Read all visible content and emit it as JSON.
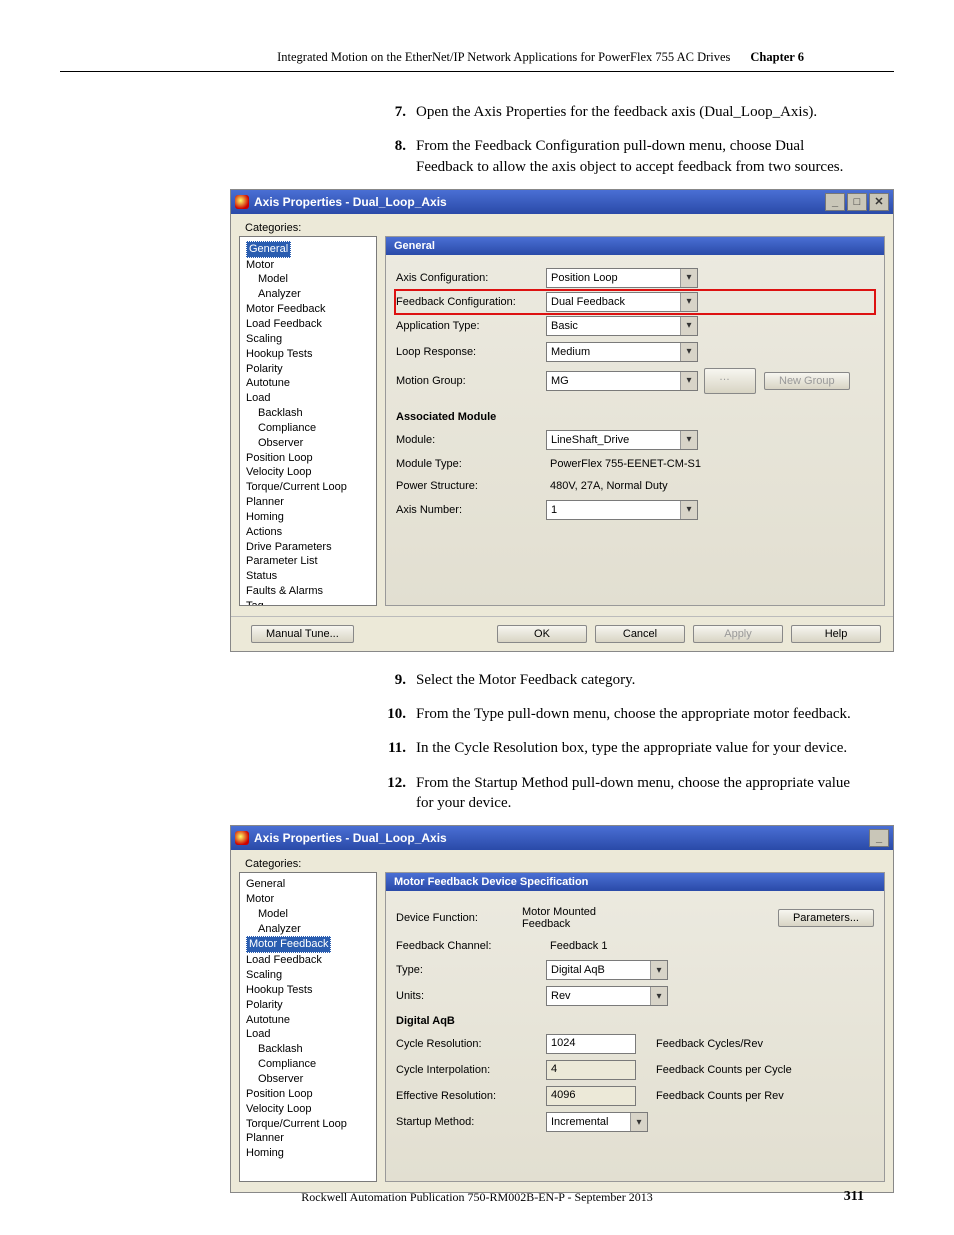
{
  "header": {
    "doc_title": "Integrated Motion on the EtherNet/IP Network Applications for PowerFlex 755 AC Drives",
    "chapter": "Chapter 6"
  },
  "steps_a": [
    {
      "n": "7.",
      "t": "Open the Axis Properties for the feedback axis (Dual_Loop_Axis)."
    },
    {
      "n": "8.",
      "t": "From the Feedback Configuration pull-down menu, choose Dual Feedback to allow the axis object to accept feedback from two sources."
    }
  ],
  "screenshot1": {
    "title": "Axis Properties - Dual_Loop_Axis",
    "categories_label": "Categories:",
    "tree": [
      {
        "l": 0,
        "label": "General",
        "sel": true
      },
      {
        "l": 0,
        "label": "Motor"
      },
      {
        "l": 1,
        "label": "Model"
      },
      {
        "l": 1,
        "label": "Analyzer"
      },
      {
        "l": 0,
        "label": "Motor Feedback"
      },
      {
        "l": 0,
        "label": "Load Feedback"
      },
      {
        "l": 0,
        "label": "Scaling"
      },
      {
        "l": 0,
        "label": "Hookup Tests"
      },
      {
        "l": 0,
        "label": "Polarity"
      },
      {
        "l": 0,
        "label": "Autotune"
      },
      {
        "l": 0,
        "label": "Load"
      },
      {
        "l": 1,
        "label": "Backlash"
      },
      {
        "l": 1,
        "label": "Compliance"
      },
      {
        "l": 1,
        "label": "Observer"
      },
      {
        "l": 0,
        "label": "Position Loop"
      },
      {
        "l": 0,
        "label": "Velocity Loop"
      },
      {
        "l": 0,
        "label": "Torque/Current Loop"
      },
      {
        "l": 0,
        "label": "Planner"
      },
      {
        "l": 0,
        "label": "Homing"
      },
      {
        "l": 0,
        "label": "Actions"
      },
      {
        "l": 0,
        "label": "Drive Parameters"
      },
      {
        "l": 0,
        "label": "Parameter List"
      },
      {
        "l": 0,
        "label": "Status"
      },
      {
        "l": 0,
        "label": "Faults & Alarms"
      },
      {
        "l": 0,
        "label": "Tag"
      }
    ],
    "panel_title": "General",
    "fields": {
      "axis_config_label": "Axis Configuration:",
      "axis_config_value": "Position Loop",
      "fb_config_label": "Feedback Configuration:",
      "fb_config_value": "Dual Feedback",
      "app_type_label": "Application Type:",
      "app_type_value": "Basic",
      "loop_resp_label": "Loop Response:",
      "loop_resp_value": "Medium",
      "motion_group_label": "Motion Group:",
      "motion_group_value": "MG",
      "new_group_btn": "New Group",
      "assoc_label": "Associated Module",
      "module_label": "Module:",
      "module_value": "LineShaft_Drive",
      "module_type_label": "Module Type:",
      "module_type_value": "PowerFlex 755-EENET-CM-S1",
      "power_struct_label": "Power Structure:",
      "power_struct_value": "480V, 27A, Normal Duty",
      "axis_num_label": "Axis Number:",
      "axis_num_value": "1"
    },
    "footer": {
      "manual_tune": "Manual Tune...",
      "ok": "OK",
      "cancel": "Cancel",
      "apply": "Apply",
      "help": "Help"
    }
  },
  "steps_b": [
    {
      "n": "9.",
      "t": "Select the Motor Feedback category."
    },
    {
      "n": "10.",
      "t": "From the Type pull-down menu, choose the appropriate motor feedback."
    },
    {
      "n": "11.",
      "t": "In the Cycle Resolution box, type the appropriate value for your device."
    },
    {
      "n": "12.",
      "t": "From the Startup Method pull-down menu, choose the appropriate value for your device."
    }
  ],
  "screenshot2": {
    "title": "Axis Properties - Dual_Loop_Axis",
    "categories_label": "Categories:",
    "tree": [
      {
        "l": 0,
        "label": "General"
      },
      {
        "l": 0,
        "label": "Motor"
      },
      {
        "l": 1,
        "label": "Model"
      },
      {
        "l": 1,
        "label": "Analyzer"
      },
      {
        "l": 0,
        "label": "Motor Feedback",
        "sel": true
      },
      {
        "l": 0,
        "label": "Load Feedback"
      },
      {
        "l": 0,
        "label": "Scaling"
      },
      {
        "l": 0,
        "label": "Hookup Tests"
      },
      {
        "l": 0,
        "label": "Polarity"
      },
      {
        "l": 0,
        "label": "Autotune"
      },
      {
        "l": 0,
        "label": "Load"
      },
      {
        "l": 1,
        "label": "Backlash"
      },
      {
        "l": 1,
        "label": "Compliance"
      },
      {
        "l": 1,
        "label": "Observer"
      },
      {
        "l": 0,
        "label": "Position Loop"
      },
      {
        "l": 0,
        "label": "Velocity Loop"
      },
      {
        "l": 0,
        "label": "Torque/Current Loop"
      },
      {
        "l": 0,
        "label": "Planner"
      },
      {
        "l": 0,
        "label": "Homing"
      }
    ],
    "panel_title": "Motor Feedback Device Specification",
    "fields": {
      "dev_func_label": "Device Function:",
      "dev_func_value": "Motor Mounted Feedback",
      "params_btn": "Parameters...",
      "fb_chan_label": "Feedback Channel:",
      "fb_chan_value": "Feedback 1",
      "type_label": "Type:",
      "type_value": "Digital AqB",
      "units_label": "Units:",
      "units_value": "Rev",
      "section_label": "Digital AqB",
      "cycle_res_label": "Cycle Resolution:",
      "cycle_res_value": "1024",
      "cycle_res_suffix": "Feedback Cycles/Rev",
      "interp_label": "Cycle Interpolation:",
      "interp_value": "4",
      "interp_suffix": "Feedback Counts per Cycle",
      "eff_res_label": "Effective Resolution:",
      "eff_res_value": "4096",
      "eff_res_suffix": "Feedback Counts per Rev",
      "startup_label": "Startup Method:",
      "startup_value": "Incremental"
    }
  },
  "publication": "Rockwell Automation Publication 750-RM002B-EN-P - September 2013",
  "page_number": "311"
}
